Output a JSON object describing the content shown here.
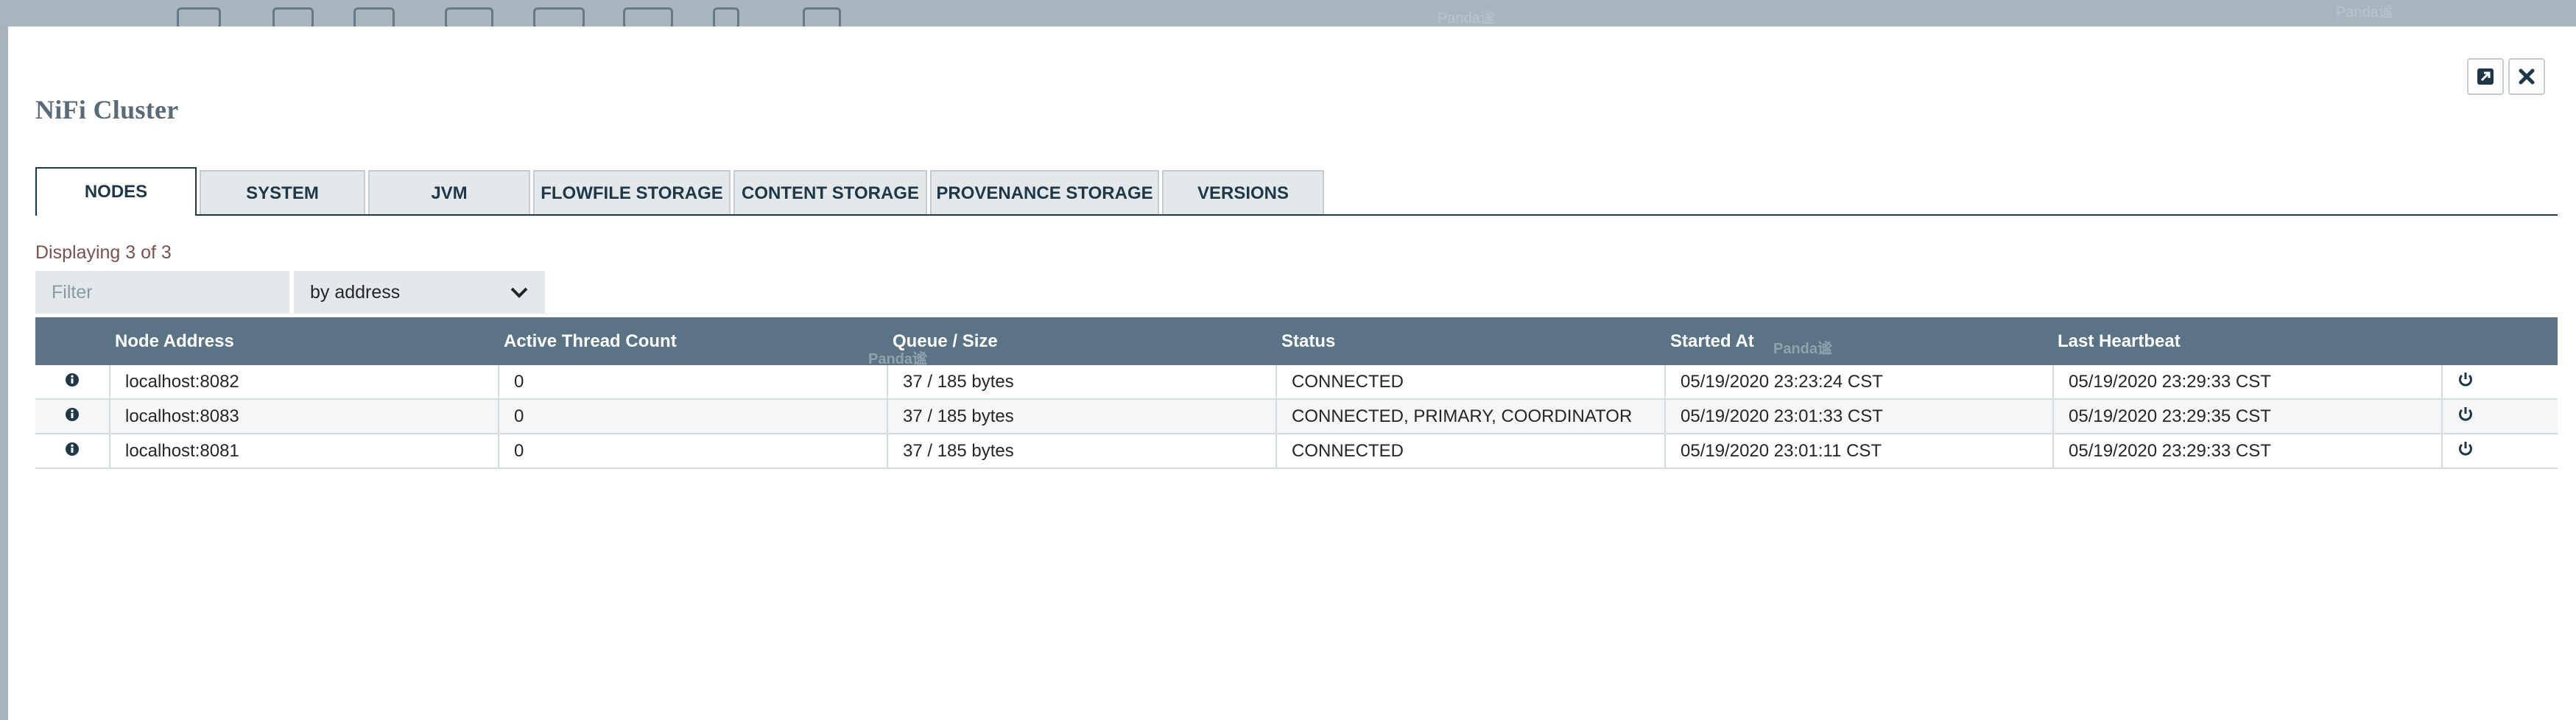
{
  "watermark": "Panda谧",
  "dialog": {
    "title": "NiFi Cluster"
  },
  "tabs": [
    {
      "label": "NODES",
      "active": true
    },
    {
      "label": "SYSTEM",
      "active": false
    },
    {
      "label": "JVM",
      "active": false
    },
    {
      "label": "FLOWFILE STORAGE",
      "active": false
    },
    {
      "label": "CONTENT STORAGE",
      "active": false
    },
    {
      "label": "PROVENANCE STORAGE",
      "active": false
    },
    {
      "label": "VERSIONS",
      "active": false
    }
  ],
  "status": {
    "displaying": "Displaying 3 of 3"
  },
  "filter": {
    "placeholder": "Filter",
    "value": "",
    "mode": "by address"
  },
  "table": {
    "columns": [
      "Node Address",
      "Active Thread Count",
      "Queue / Size",
      "Status",
      "Started At",
      "Last Heartbeat"
    ],
    "rows": [
      {
        "address": "localhost:8082",
        "threads": "0",
        "queue": "37 / 185 bytes",
        "status": "CONNECTED",
        "started": "05/19/2020 23:23:24 CST",
        "heartbeat": "05/19/2020 23:29:33 CST"
      },
      {
        "address": "localhost:8083",
        "threads": "0",
        "queue": "37 / 185 bytes",
        "status": "CONNECTED, PRIMARY, COORDINATOR",
        "started": "05/19/2020 23:01:33 CST",
        "heartbeat": "05/19/2020 23:29:35 CST"
      },
      {
        "address": "localhost:8081",
        "threads": "0",
        "queue": "37 / 185 bytes",
        "status": "CONNECTED",
        "started": "05/19/2020 23:01:11 CST",
        "heartbeat": "05/19/2020 23:29:33 CST"
      }
    ]
  },
  "icons": {
    "row_info": "info-icon",
    "row_action": "power-icon",
    "popout": "popout-icon",
    "close": "close-icon"
  },
  "colors": {
    "header_bg": "#5a7485",
    "accent": "#1f3847",
    "count_text": "#775351"
  }
}
